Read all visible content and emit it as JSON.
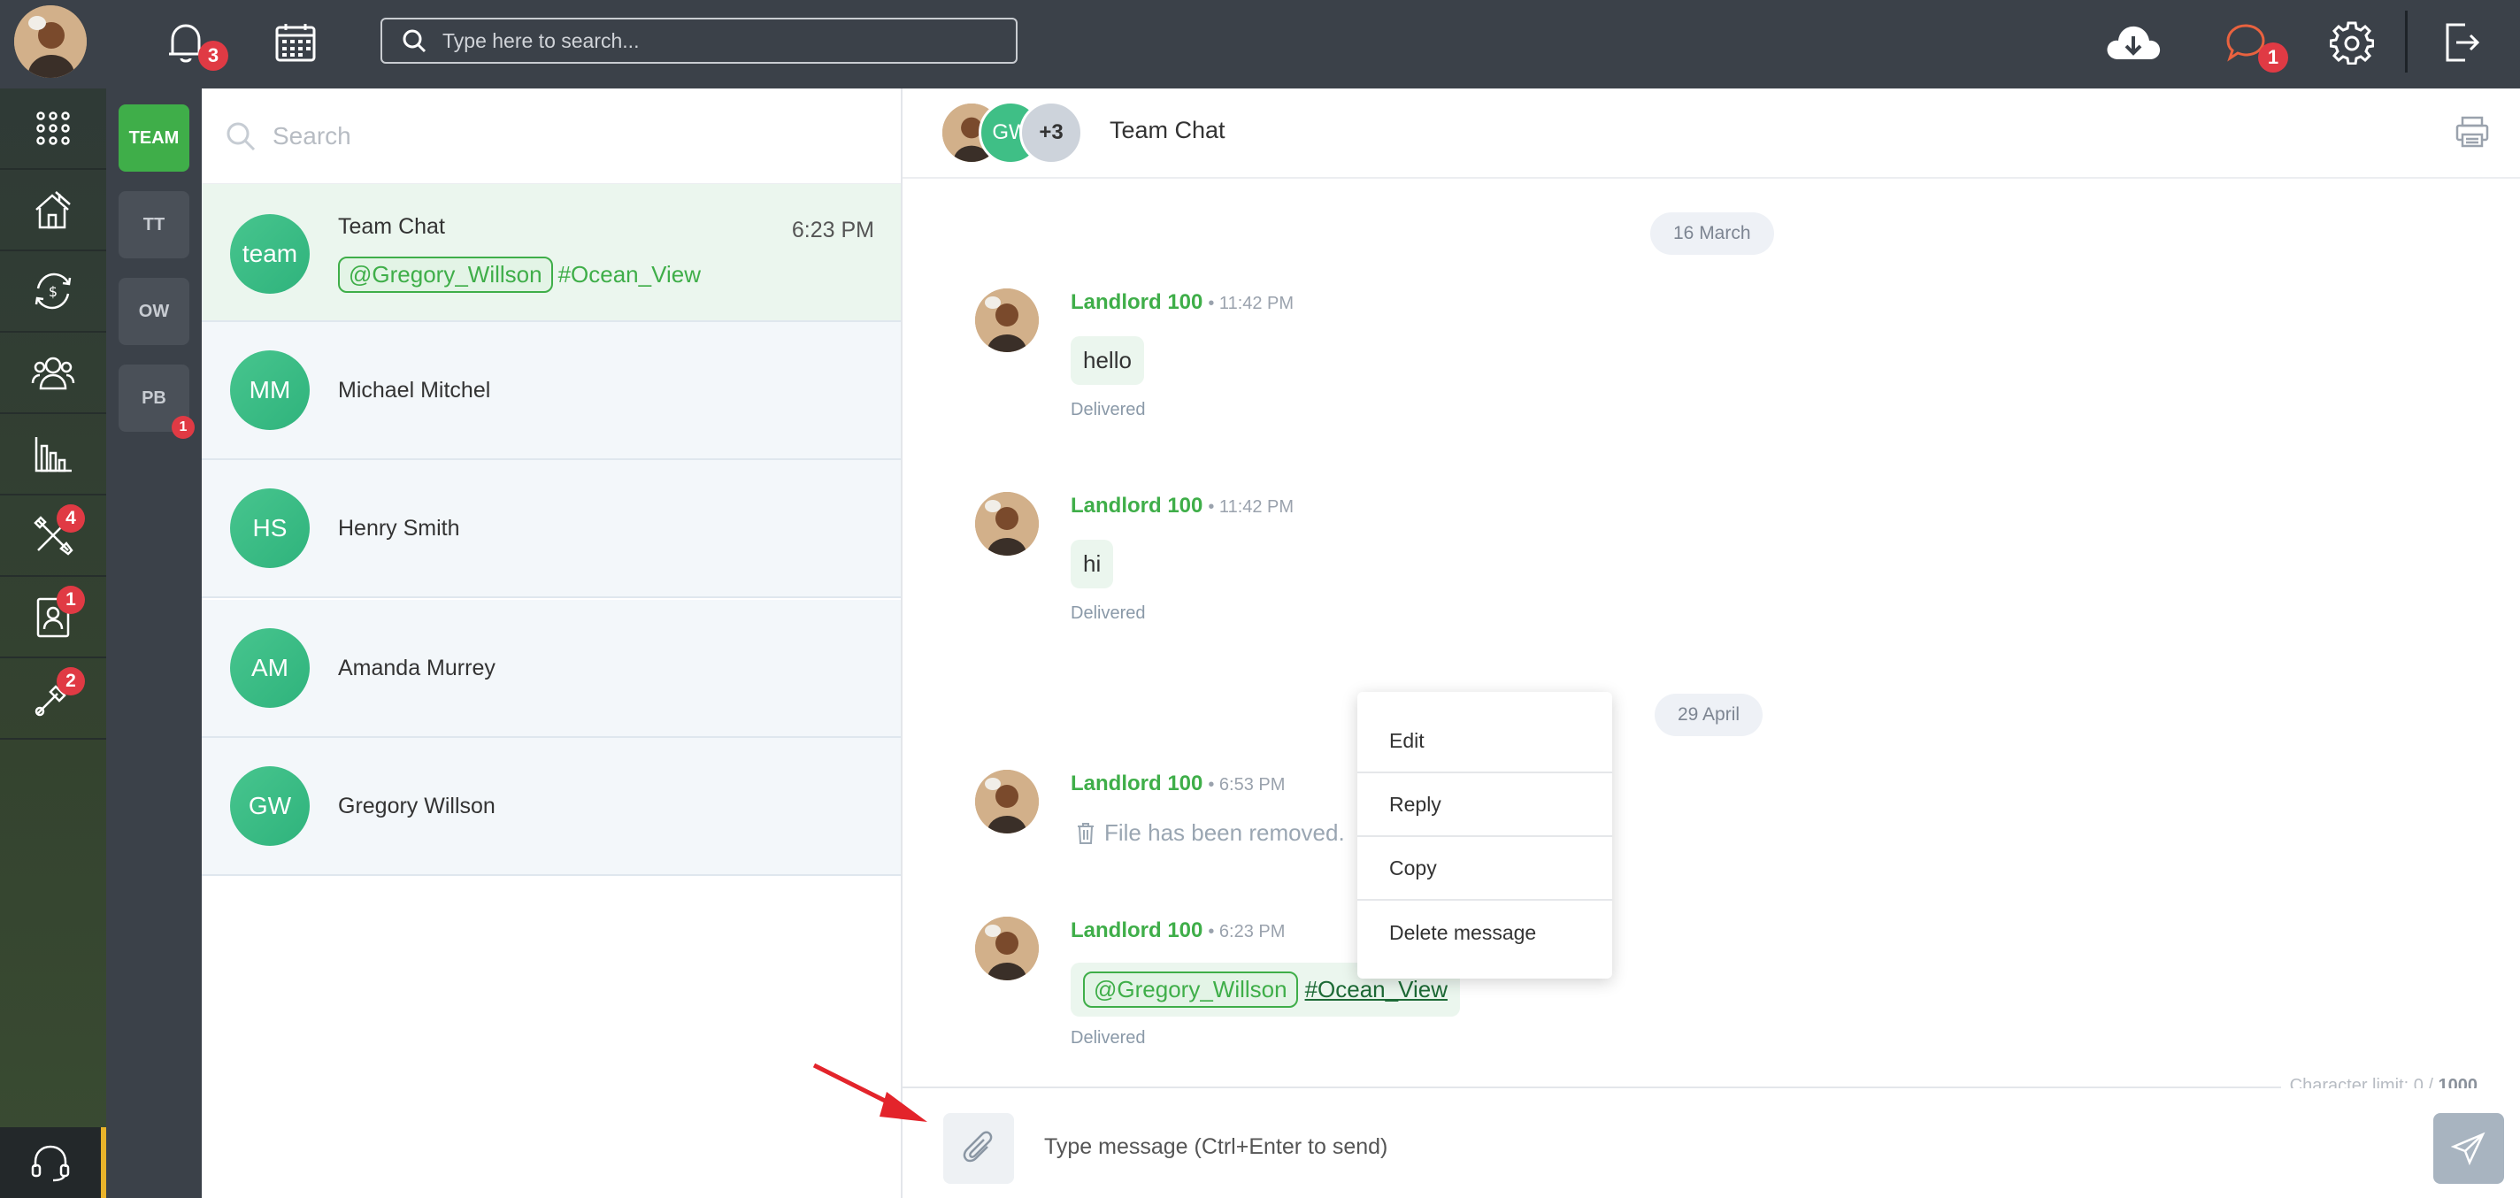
{
  "topbar": {
    "notifications_count": "3",
    "search_placeholder": "Type here to search...",
    "messages_count": "1"
  },
  "leftnav": {
    "items": [
      {
        "icon": "apps-grid-icon",
        "badge": ""
      },
      {
        "icon": "properties-icon",
        "badge": ""
      },
      {
        "icon": "transactions-icon",
        "badge": ""
      },
      {
        "icon": "contacts-icon",
        "badge": ""
      },
      {
        "icon": "reports-icon",
        "badge": ""
      },
      {
        "icon": "maintenance-icon",
        "badge": "4"
      },
      {
        "icon": "tenant-profile-icon",
        "badge": "1"
      },
      {
        "icon": "tools-icon",
        "badge": "2"
      }
    ],
    "support_icon": "headset-icon"
  },
  "groups": [
    {
      "label": "TEAM",
      "active": true,
      "badge": ""
    },
    {
      "label": "TT",
      "active": false,
      "badge": ""
    },
    {
      "label": "OW",
      "active": false,
      "badge": ""
    },
    {
      "label": "PB",
      "active": false,
      "badge": "1"
    }
  ],
  "chatlist": {
    "search_placeholder": "Search",
    "chats": [
      {
        "initials": "team",
        "name": "Team Chat",
        "time": "6:23 PM",
        "mention": "@Gregory_Willson",
        "hashtag": "#Ocean_View"
      },
      {
        "initials": "MM",
        "name": "Michael Mitchel"
      },
      {
        "initials": "HS",
        "name": "Henry Smith"
      },
      {
        "initials": "AM",
        "name": "Amanda Murrey"
      },
      {
        "initials": "GW",
        "name": "Gregory Willson"
      }
    ]
  },
  "chat": {
    "title": "Team Chat",
    "header_avatar_initials": "GW",
    "header_more": "+3",
    "dates": [
      "16 March",
      "29 April"
    ],
    "messages": [
      {
        "author": "Landlord 100",
        "time": "• 11:42 PM",
        "text": "hello",
        "status": "Delivered"
      },
      {
        "author": "Landlord 100",
        "time": "• 11:42 PM",
        "text": "hi",
        "status": "Delivered"
      },
      {
        "author": "Landlord 100",
        "time": "• 6:53 PM",
        "text": "File has been removed.",
        "status": ""
      },
      {
        "author": "Landlord 100",
        "time": "• 6:23 PM",
        "mention": "@Gregory_Willson",
        "hashtag": "#Ocean_View",
        "status": "Delivered"
      }
    ],
    "context_menu": [
      "Edit",
      "Reply",
      "Copy",
      "Delete message"
    ],
    "char_limit_label": "Character limit: 0 / ",
    "char_limit_max": "1000",
    "composer_placeholder": "Type message (Ctrl+Enter to send)"
  },
  "colors": {
    "accent_green": "#3fae49",
    "badge_red": "#e03a44",
    "topbar": "#3b4149",
    "annotation_arrow": "#e3242b"
  }
}
